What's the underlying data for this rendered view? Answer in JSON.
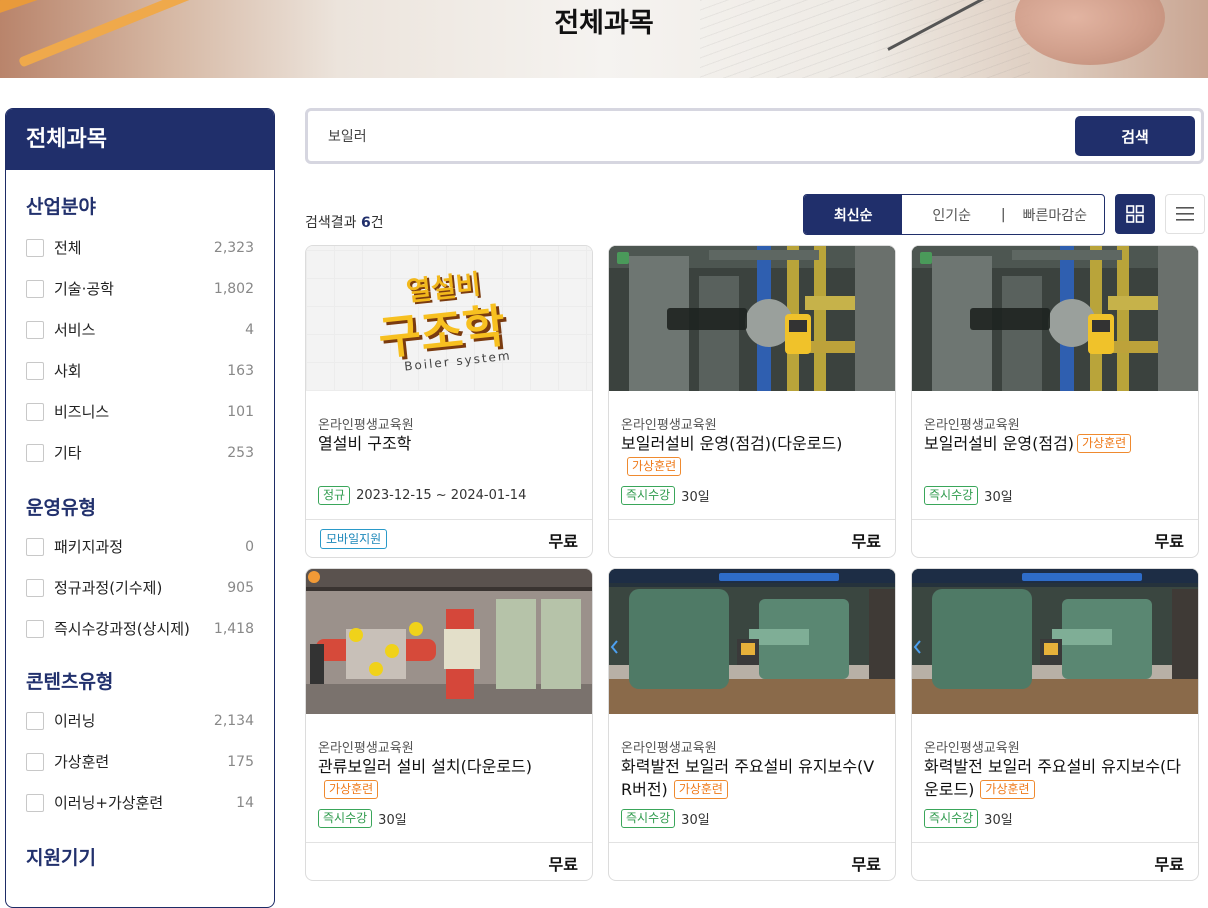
{
  "banner": {
    "title": "전체과목"
  },
  "sidebar": {
    "title": "전체과목",
    "groups": [
      {
        "title": "산업분야",
        "items": [
          {
            "label": "전체",
            "count": "2,323"
          },
          {
            "label": "기술·공학",
            "count": "1,802"
          },
          {
            "label": "서비스",
            "count": "4"
          },
          {
            "label": "사회",
            "count": "163"
          },
          {
            "label": "비즈니스",
            "count": "101"
          },
          {
            "label": "기타",
            "count": "253"
          }
        ]
      },
      {
        "title": "운영유형",
        "items": [
          {
            "label": "패키지과정",
            "count": "0"
          },
          {
            "label": "정규과정(기수제)",
            "count": "905"
          },
          {
            "label": "즉시수강과정(상시제)",
            "count": "1,418"
          }
        ]
      },
      {
        "title": "콘텐츠유형",
        "items": [
          {
            "label": "이러닝",
            "count": "2,134"
          },
          {
            "label": "가상훈련",
            "count": "175"
          },
          {
            "label": "이러닝+가상훈련",
            "count": "14"
          }
        ]
      },
      {
        "title": "지원기기",
        "items": []
      }
    ]
  },
  "search": {
    "value": "보일러",
    "button": "검색"
  },
  "results": {
    "prefix": "검색결과 ",
    "count": "6",
    "suffix": "건"
  },
  "sort": {
    "options": [
      "최신순",
      "인기순",
      "빠른마감순"
    ],
    "active": "최신순",
    "separator": "|"
  },
  "colors": {
    "navy": "#202f6b",
    "orange": "#ef7a1a",
    "green": "#2d9a4b",
    "blue": "#1d88ba"
  },
  "cards": [
    {
      "provider": "온라인평생교육원",
      "title": "열설비 구조학",
      "vr_tag": "",
      "status_tag": "정규",
      "meta_text": "2023-12-15 ~ 2024-01-14",
      "mobile_tag": "모바일지원",
      "price": "무료",
      "thumb_logo_top": "열설비",
      "thumb_logo_main": "구조학",
      "thumb_logo_sub": "Boiler system"
    },
    {
      "provider": "온라인평생교육원",
      "title": "보일러설비 운영(점검)(다운로드)",
      "vr_tag": "가상훈련",
      "status_tag": "즉시수강",
      "meta_text": "30일",
      "mobile_tag": "",
      "price": "무료"
    },
    {
      "provider": "온라인평생교육원",
      "title": "보일러설비 운영(점검)",
      "vr_tag": "가상훈련",
      "status_tag": "즉시수강",
      "meta_text": "30일",
      "mobile_tag": "",
      "price": "무료"
    },
    {
      "provider": "온라인평생교육원",
      "title": "관류보일러 설비 설치(다운로드)",
      "vr_tag": "가상훈련",
      "status_tag": "즉시수강",
      "meta_text": "30일",
      "mobile_tag": "",
      "price": "무료"
    },
    {
      "provider": "온라인평생교육원",
      "title": "화력발전 보일러 주요설비 유지보수(VR버전)",
      "vr_tag": "가상훈련",
      "status_tag": "즉시수강",
      "meta_text": "30일",
      "mobile_tag": "",
      "price": "무료"
    },
    {
      "provider": "온라인평생교육원",
      "title": "화력발전 보일러 주요설비 유지보수(다운로드)",
      "vr_tag": "가상훈련",
      "status_tag": "즉시수강",
      "meta_text": "30일",
      "mobile_tag": "",
      "price": "무료"
    }
  ]
}
